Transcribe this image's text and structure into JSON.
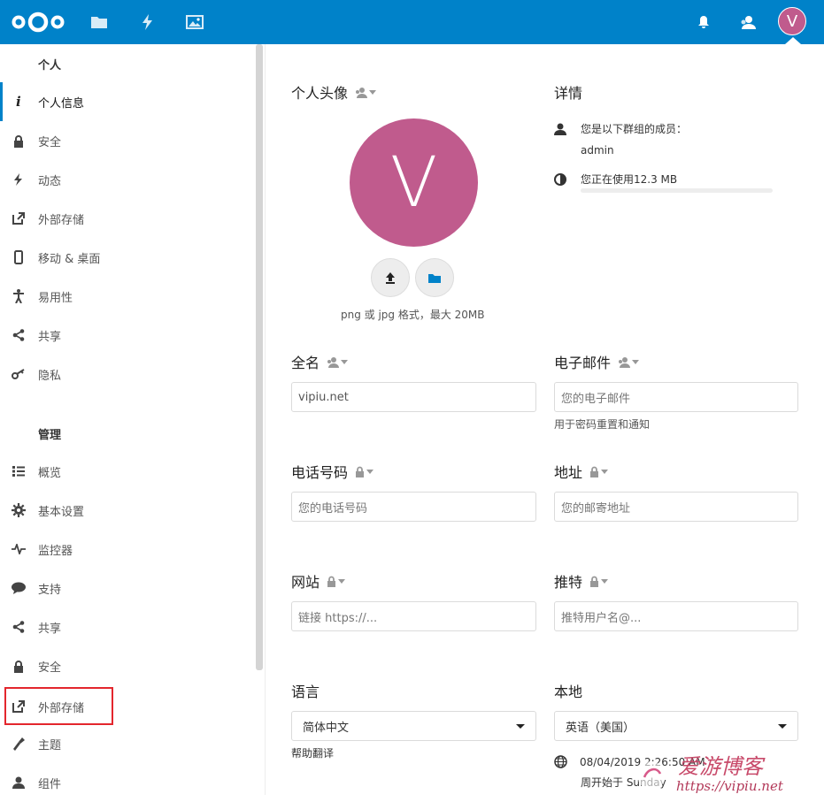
{
  "header": {
    "user_initial": "V",
    "avatar_color": "#c05b8d",
    "brand_color": "#0082c9",
    "app_icons": [
      "files-icon",
      "activity-icon",
      "gallery-icon"
    ],
    "right_icons": [
      "notifications-icon",
      "contacts-icon"
    ]
  },
  "sidebar": {
    "personal_title": "个人",
    "personal_items": [
      {
        "label": "个人信息",
        "icon": "info-icon",
        "active": true
      },
      {
        "label": "安全",
        "icon": "lock-icon"
      },
      {
        "label": "动态",
        "icon": "activity-icon"
      },
      {
        "label": "外部存储",
        "icon": "external-icon"
      },
      {
        "label": "移动 & 桌面",
        "icon": "mobile-icon"
      },
      {
        "label": "易用性",
        "icon": "accessibility-icon"
      },
      {
        "label": "共享",
        "icon": "share-icon"
      },
      {
        "label": "隐私",
        "icon": "key-icon"
      }
    ],
    "admin_title": "管理",
    "admin_items": [
      {
        "label": "概览",
        "icon": "list-icon"
      },
      {
        "label": "基本设置",
        "icon": "gear-icon"
      },
      {
        "label": "监控器",
        "icon": "monitor-icon"
      },
      {
        "label": "支持",
        "icon": "comment-icon"
      },
      {
        "label": "共享",
        "icon": "share-icon"
      },
      {
        "label": "安全",
        "icon": "lock-icon"
      },
      {
        "label": "外部存储",
        "icon": "external-icon"
      },
      {
        "label": "主题",
        "icon": "theming-icon"
      },
      {
        "label": "组件",
        "icon": "user-icon"
      }
    ]
  },
  "profile": {
    "avatar_title": "个人头像",
    "avatar_initial": "V",
    "avatar_hint": "png 或 jpg 格式，最大 20MB",
    "details_title": "详情",
    "groups_label": "您是以下群组的成员：",
    "group_name": "admin",
    "quota_label": "您正在使用12.3 MB",
    "quota_fraction": 0.0,
    "fullname": {
      "label": "全名",
      "value": "vipiu.net"
    },
    "email": {
      "label": "电子邮件",
      "placeholder": "您的电子邮件",
      "hint": "用于密码重置和通知"
    },
    "phone": {
      "label": "电话号码",
      "placeholder": "您的电话号码"
    },
    "address": {
      "label": "地址",
      "placeholder": "您的邮寄地址"
    },
    "website": {
      "label": "网站",
      "placeholder": "链接 https://..."
    },
    "twitter": {
      "label": "推特",
      "placeholder": "推特用户名@..."
    },
    "language": {
      "label": "语言",
      "value": "简体中文",
      "help": "帮助翻译"
    },
    "locale": {
      "label": "本地",
      "value": "英语（美国）",
      "time": "08/04/2019 2:26:50 AM",
      "week_start": "周开始于 Sunday"
    }
  },
  "watermark": {
    "title": "爱游博客",
    "url": "https://vipiu.net"
  }
}
